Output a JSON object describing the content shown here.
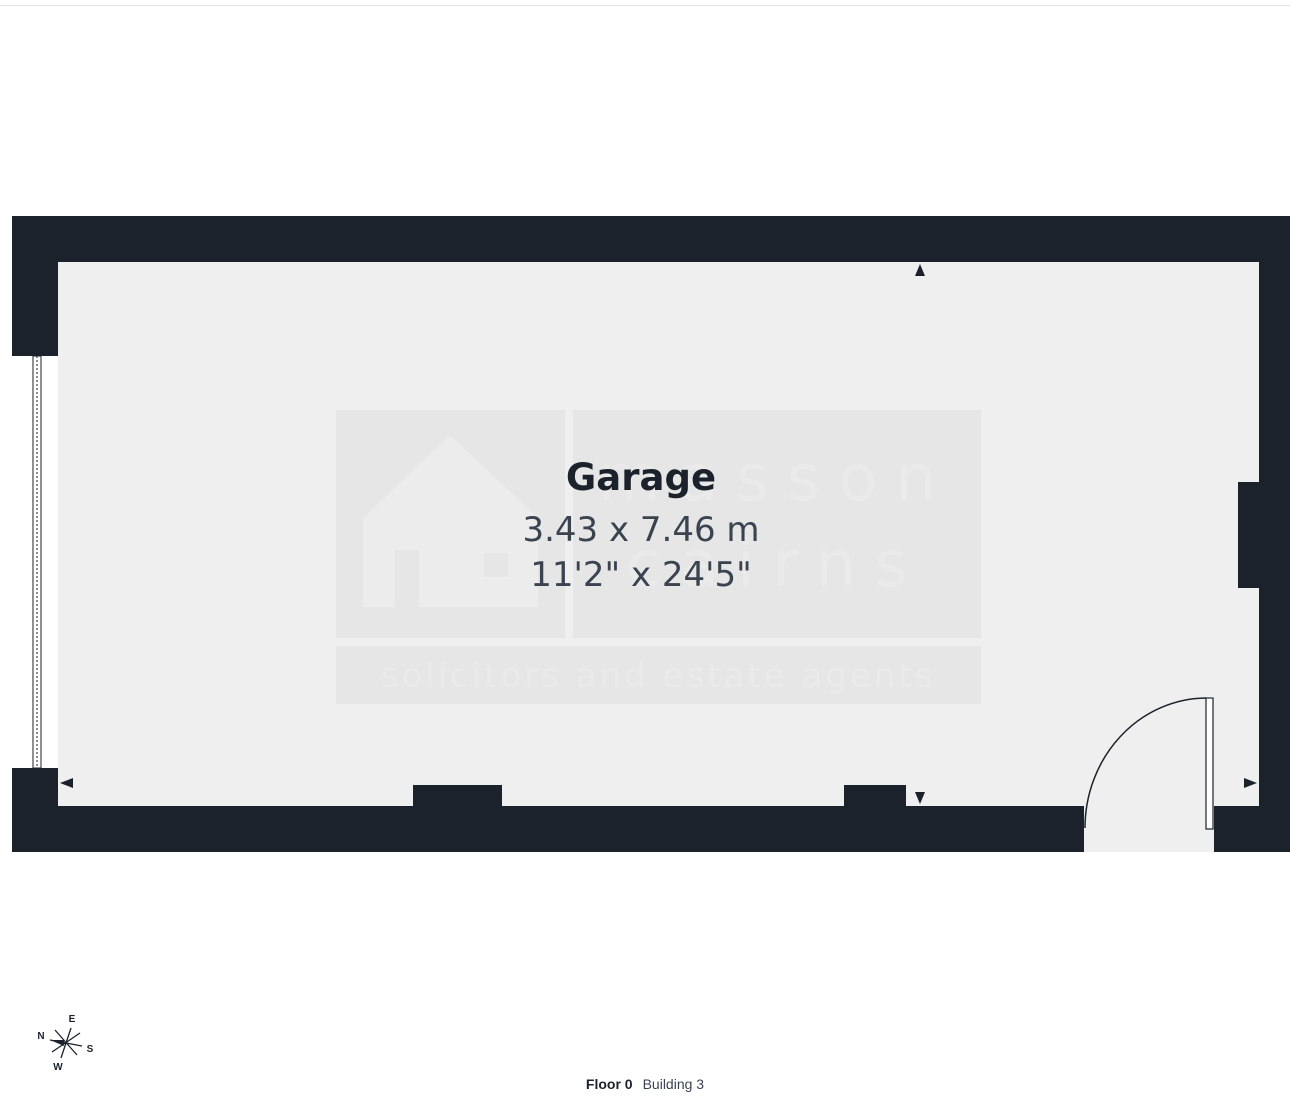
{
  "room": {
    "name": "Garage",
    "size_metric": "3.43 x 7.46 m",
    "size_imperial": "11'2\" x 24'5\""
  },
  "watermark": {
    "brand_line_1": "masson",
    "brand_line_2": "cairns",
    "tagline": "solicitors and estate agents"
  },
  "compass": {
    "n": "N",
    "e": "E",
    "s": "S",
    "w": "W"
  },
  "footer": {
    "floor": "Floor 0",
    "building": "Building 3"
  },
  "colors": {
    "wall": "#1b222b",
    "floor_fill": "#efefef",
    "watermark": "#e6e6e6"
  }
}
